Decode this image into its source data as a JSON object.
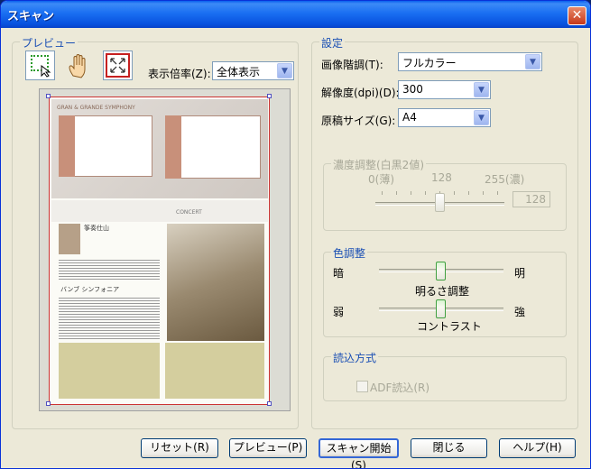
{
  "window": {
    "title": "スキャン",
    "close": "✕"
  },
  "preview_group": {
    "label": "プレビュー",
    "zoom_label": "表示倍率(Z):",
    "zoom_value": "全体表示"
  },
  "doc": {
    "heading1": "GRAN & GRANDE SYMPHONY",
    "heading2": "CONCERT",
    "section1": "筝奏仕山",
    "section2": "バンブ シンフォニア"
  },
  "settings": {
    "label": "設定",
    "color_mode_label": "画像階調(T):",
    "color_mode_value": "フルカラー",
    "resolution_label": "解像度(dpi)(D):",
    "resolution_value": "300",
    "size_label": "原稿サイズ(G):",
    "size_value": "A4"
  },
  "density": {
    "label": "濃度調整(白黒2値)",
    "min_label": "0(薄)",
    "mid_label": "128",
    "max_label": "255(濃)",
    "value": "128",
    "level": 128
  },
  "color_adjust": {
    "label": "色調整",
    "brightness_left": "暗",
    "brightness_right": "明",
    "brightness_caption": "明るさ調整",
    "contrast_left": "弱",
    "contrast_right": "強",
    "contrast_caption": "コントラスト",
    "brightness_level": 0.5,
    "contrast_level": 0.5
  },
  "read_method": {
    "label": "読込方式",
    "adf_label": "ADF読込(R)",
    "adf_checked": false
  },
  "buttons": {
    "reset": "リセット(R)",
    "preview": "プレビュー(P)",
    "scan": "スキャン開始(S)",
    "close": "閉じる",
    "help": "ヘルプ(H)"
  }
}
